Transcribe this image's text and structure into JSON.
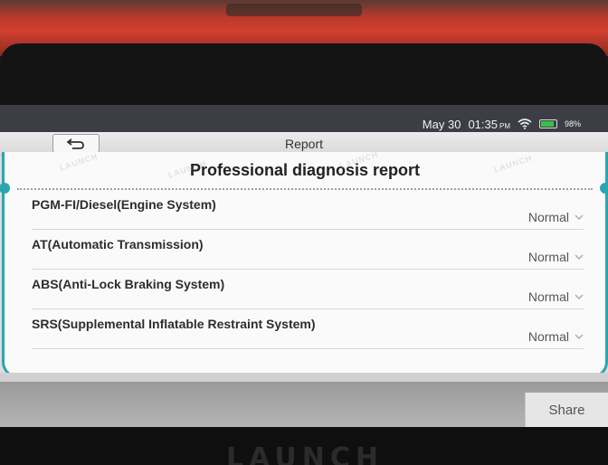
{
  "statusbar": {
    "date": "May 30",
    "time": "01:35",
    "ampm": "PM",
    "battery": "98%"
  },
  "titlebar": {
    "title": "Report"
  },
  "report": {
    "title": "Professional diagnosis report",
    "watermark": "LAUNCH",
    "rows": [
      {
        "label": "PGM-FI/Diesel(Engine System)",
        "status": "Normal"
      },
      {
        "label": "AT(Automatic Transmission)",
        "status": "Normal"
      },
      {
        "label": "ABS(Anti-Lock Braking System)",
        "status": "Normal"
      },
      {
        "label": "SRS(Supplemental Inflatable Restraint System)",
        "status": "Normal"
      }
    ]
  },
  "footer": {
    "share_label": "Share"
  },
  "device": {
    "logo": "LAUNCH"
  },
  "colors": {
    "accent": "#2aa6b2",
    "battery": "#33c24a",
    "device_red": "#d2402e"
  }
}
